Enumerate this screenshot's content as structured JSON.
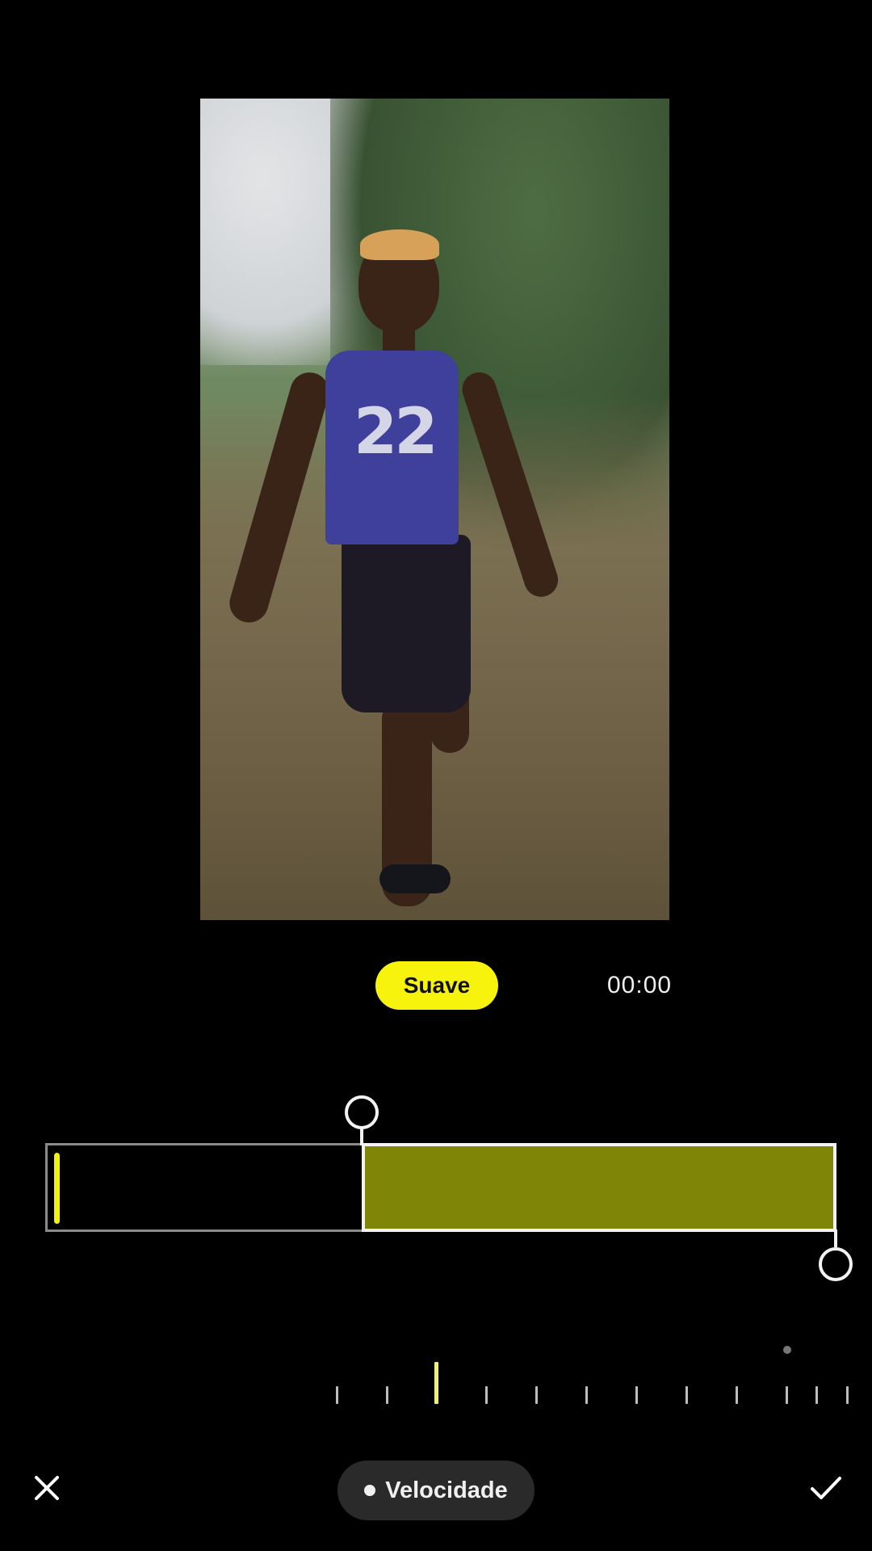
{
  "preview": {
    "alt": "Foto de pessoa em pé num campo"
  },
  "mode": {
    "label": "Suave",
    "accent_color": "#f8f30d"
  },
  "time": {
    "value": "00:00"
  },
  "timeline": {
    "fill_color": "#7f8506",
    "playhead_color": "#f3f10c"
  },
  "ruler": {
    "active_tick_index": 2,
    "tick_count": 11
  },
  "bottom_bar": {
    "close_icon": "close-icon",
    "confirm_icon": "check-icon",
    "mode_tab_label": "Velocidade"
  }
}
